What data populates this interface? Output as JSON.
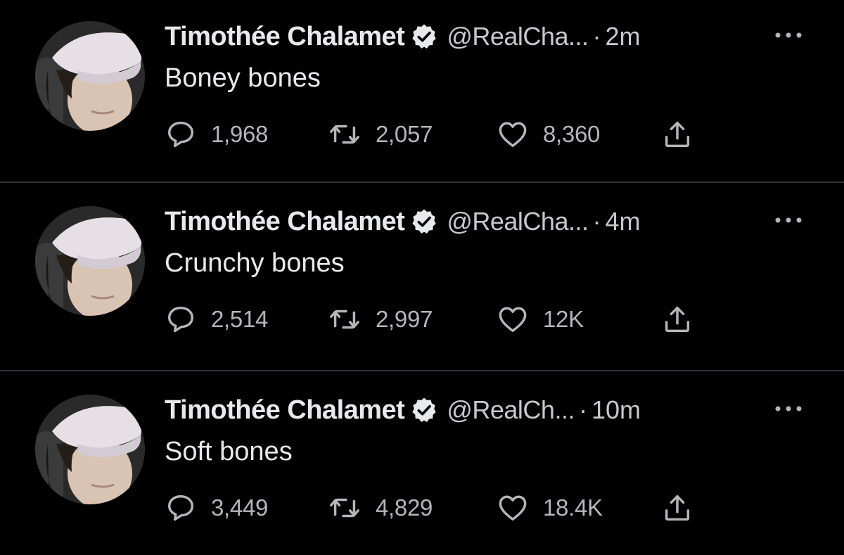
{
  "colors": {
    "background": "#000000",
    "divider": "#2f3336",
    "name": "#e7e9ea",
    "meta": "#c5c9cc",
    "action": "#b3b7ba"
  },
  "tweets": [
    {
      "name": "Timothée Chalamet",
      "handle": "@RealCha...",
      "dot": "·",
      "time": "2m",
      "text": "Boney bones",
      "replies": "1,968",
      "retweets": "2,057",
      "likes": "8,360",
      "icons": [
        "verified-badge-icon",
        "more-icon",
        "reply-icon",
        "retweet-icon",
        "like-icon",
        "share-icon"
      ]
    },
    {
      "name": "Timothée Chalamet",
      "handle": "@RealCha...",
      "dot": "·",
      "time": "4m",
      "text": "Crunchy bones",
      "replies": "2,514",
      "retweets": "2,997",
      "likes": "12K",
      "icons": [
        "verified-badge-icon",
        "more-icon",
        "reply-icon",
        "retweet-icon",
        "like-icon",
        "share-icon"
      ]
    },
    {
      "name": "Timothée Chalamet",
      "handle": "@RealCh...",
      "dot": "·",
      "time": "10m",
      "text": "Soft bones",
      "replies": "3,449",
      "retweets": "4,829",
      "likes": "18.4K",
      "icons": [
        "verified-badge-icon",
        "more-icon",
        "reply-icon",
        "retweet-icon",
        "like-icon",
        "share-icon"
      ]
    }
  ]
}
